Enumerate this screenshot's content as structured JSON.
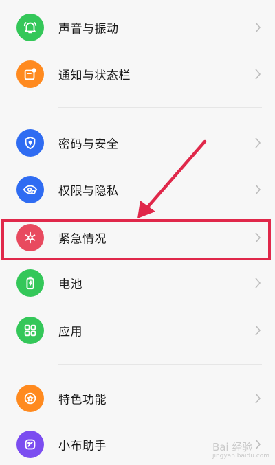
{
  "settings": {
    "items": [
      {
        "label": "声音与振动",
        "icon": "bell-icon",
        "color": "#34c759"
      },
      {
        "label": "通知与状态栏",
        "icon": "notification-icon",
        "color": "#ff8a1f"
      },
      {
        "label": "密码与安全",
        "icon": "shield-lock-icon",
        "color": "#2f6cf2"
      },
      {
        "label": "权限与隐私",
        "icon": "eye-privacy-icon",
        "color": "#2f6cf2"
      },
      {
        "label": "紧急情况",
        "icon": "asterisk-icon",
        "color": "#e84a5f"
      },
      {
        "label": "电池",
        "icon": "battery-icon",
        "color": "#34c759"
      },
      {
        "label": "应用",
        "icon": "apps-grid-icon",
        "color": "#34c759"
      },
      {
        "label": "特色功能",
        "icon": "star-icon",
        "color": "#ff8a1f"
      },
      {
        "label": "小布助手",
        "icon": "assistant-icon",
        "color": "#7b4df0"
      }
    ]
  },
  "annotation": {
    "highlight_color": "#e0284a",
    "highlighted_item": "紧急情况"
  },
  "watermark": {
    "text": "Bai 经验",
    "subtext": "jingyan.baidu.com"
  }
}
